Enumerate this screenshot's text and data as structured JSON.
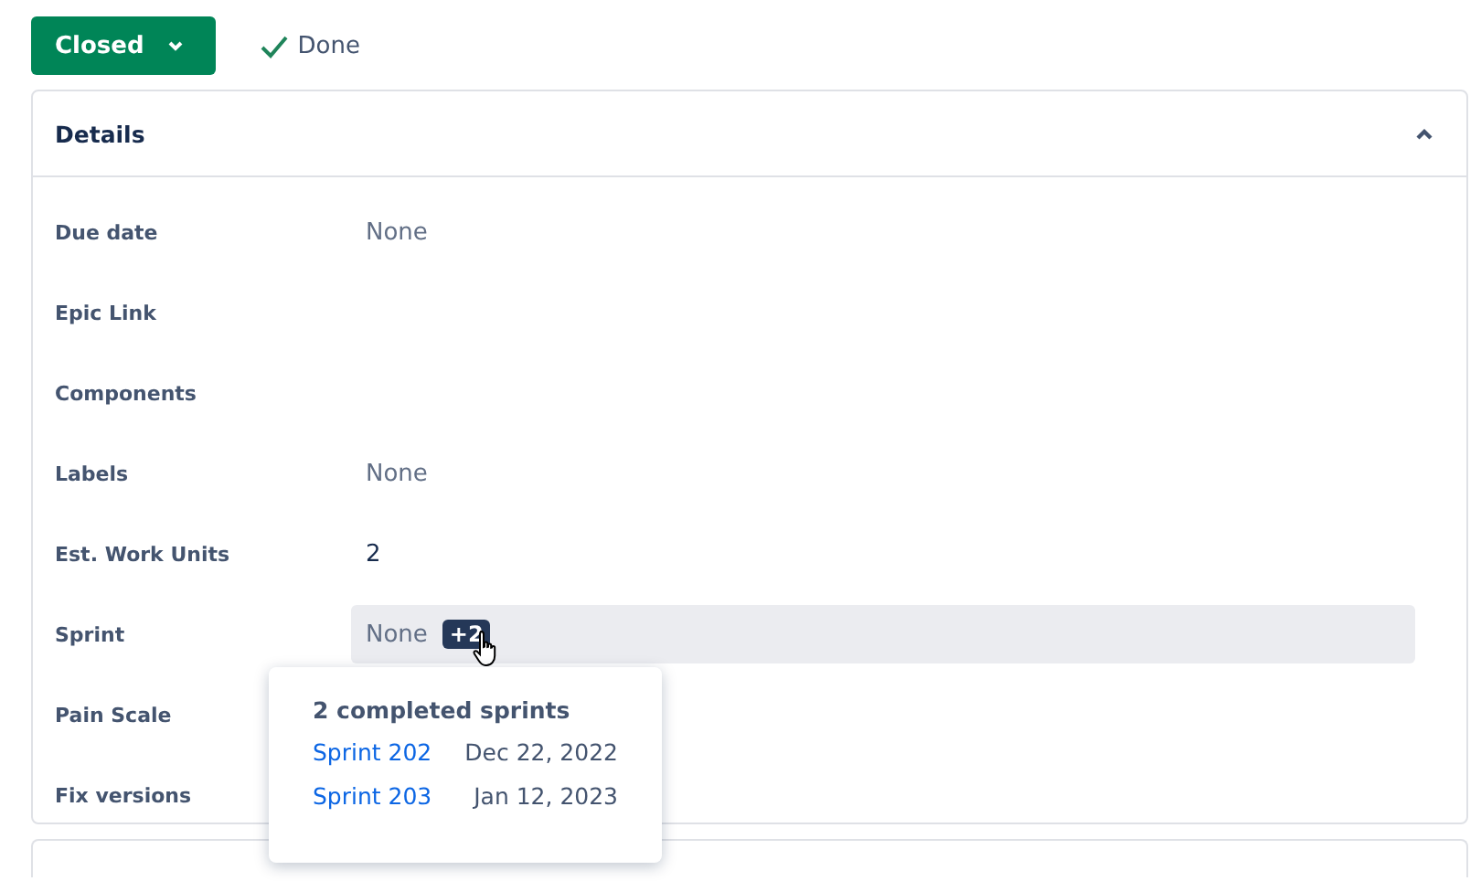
{
  "status_button": {
    "label": "Closed"
  },
  "resolution": {
    "label": "Done"
  },
  "details": {
    "title": "Details",
    "expanded": true,
    "rows": [
      {
        "label": "Due date",
        "kind": "none",
        "value": "None"
      },
      {
        "label": "Epic Link",
        "kind": "empty"
      },
      {
        "label": "Components",
        "kind": "empty"
      },
      {
        "label": "Labels",
        "kind": "none",
        "value": "None"
      },
      {
        "label": "Est. Work Units",
        "kind": "text",
        "value": "2"
      },
      {
        "label": "Sprint",
        "kind": "sprint",
        "value": "None",
        "badge": "+2"
      },
      {
        "label": "Pain Scale",
        "kind": "empty"
      },
      {
        "label": "Fix versions",
        "kind": "empty"
      }
    ]
  },
  "sprint_popup": {
    "title": "2 completed sprints",
    "sprints": [
      {
        "name": "Sprint 202",
        "date": "Dec 22, 2022"
      },
      {
        "name": "Sprint 203",
        "date": "Jan 12, 2023"
      }
    ]
  }
}
